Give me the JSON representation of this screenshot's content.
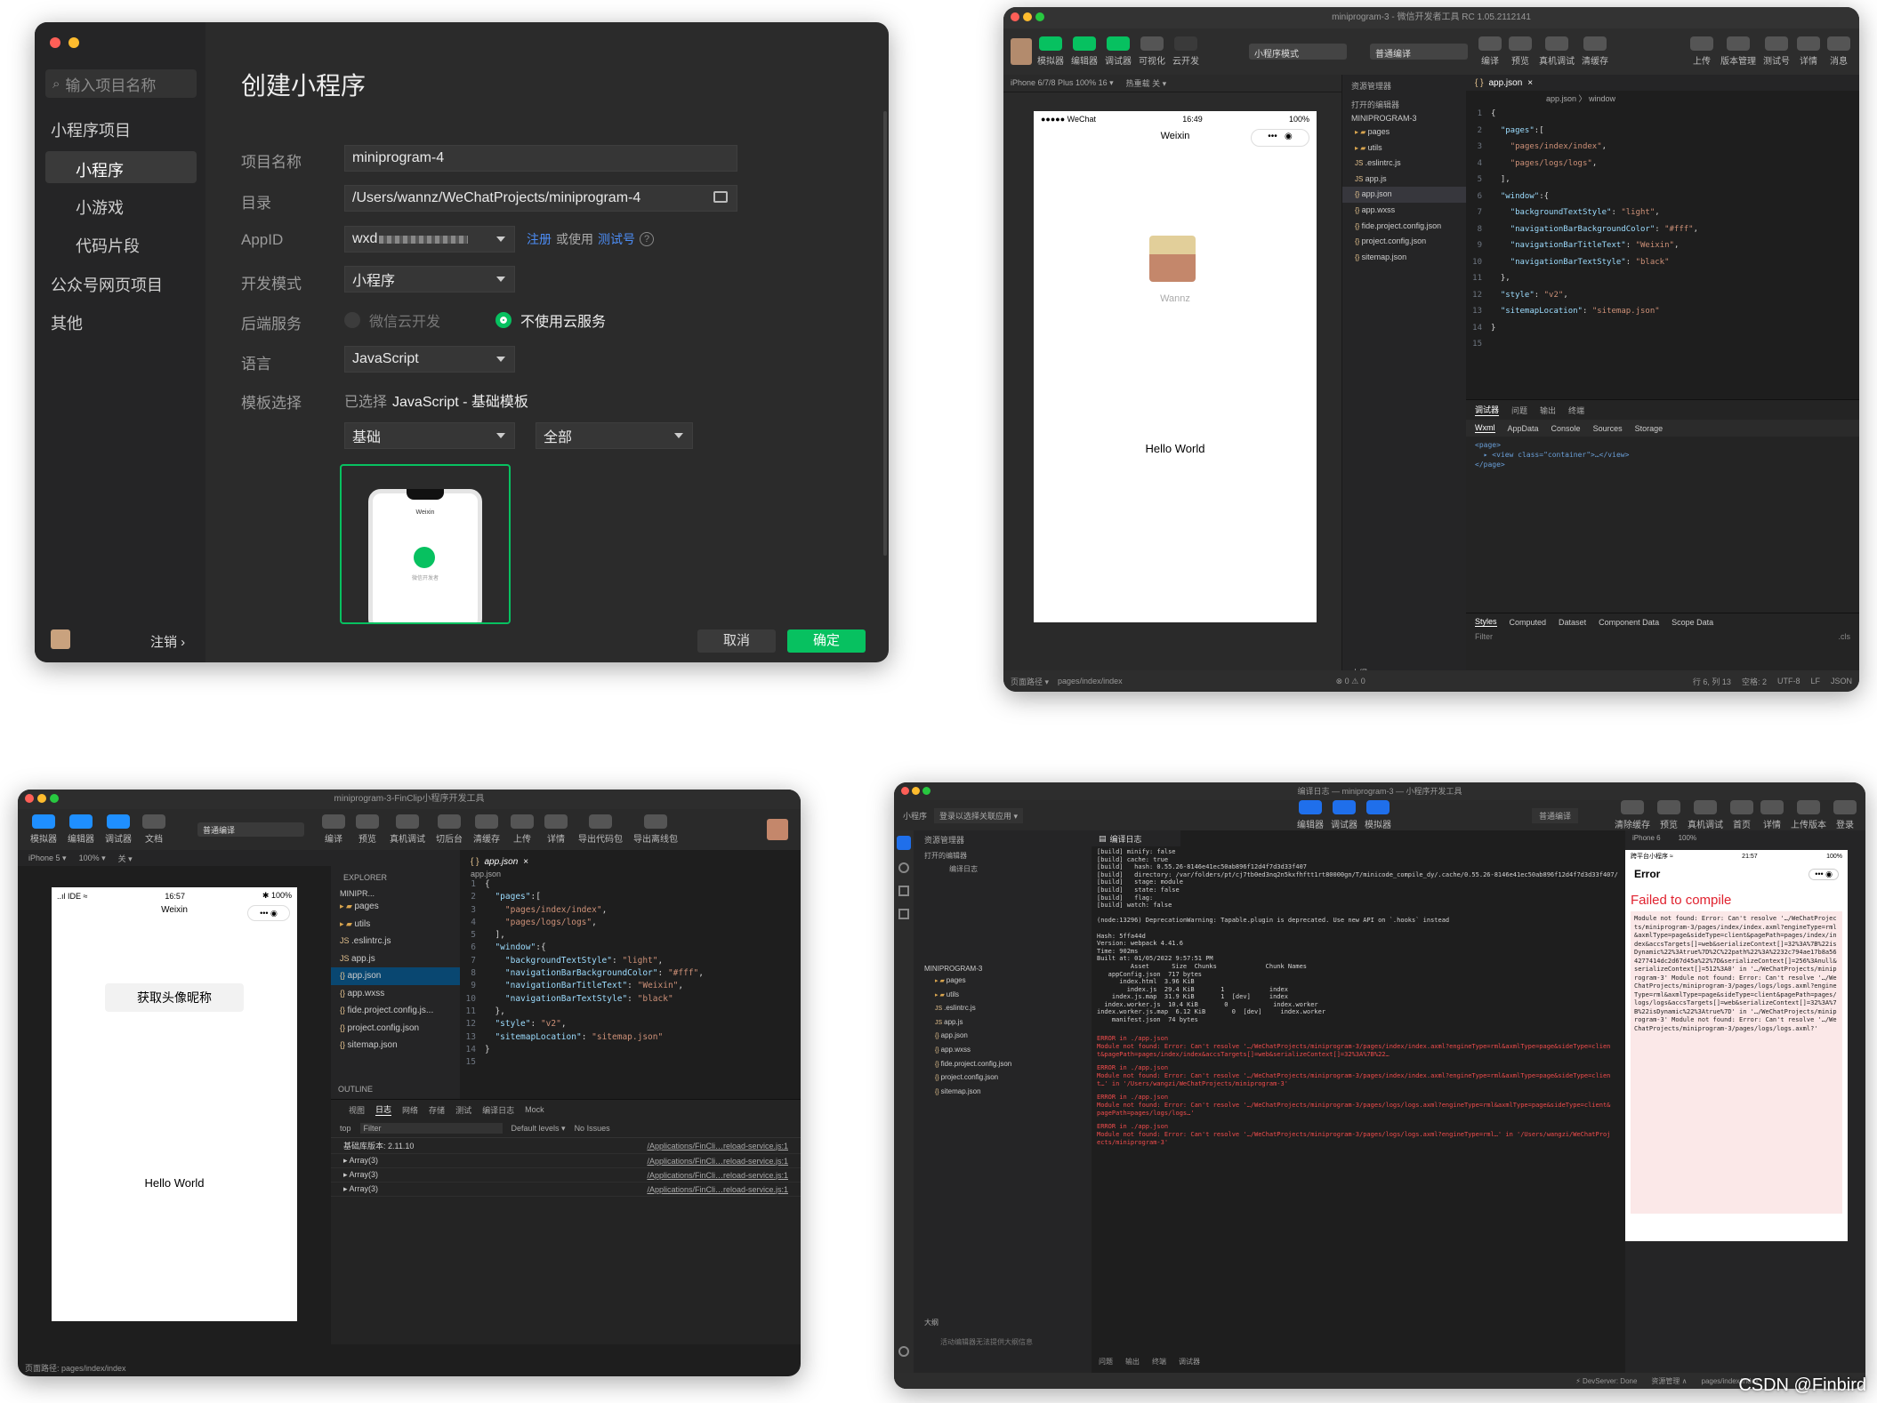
{
  "w1": {
    "search_placeholder": "输入项目名称",
    "nav": {
      "section1": "小程序项目",
      "mini": "小程序",
      "game": "小游戏",
      "snippet": "代码片段",
      "section2": "公众号网页项目",
      "other": "其他"
    },
    "logout": "注销 ›",
    "title": "创建小程序",
    "labels": {
      "name": "项目名称",
      "dir": "目录",
      "appid": "AppID",
      "mode": "开发模式",
      "backend": "后端服务",
      "lang": "语言",
      "template": "模板选择"
    },
    "values": {
      "name": "miniprogram-4",
      "dir": "/Users/wannz/WeChatProjects/miniprogram-4",
      "appid": "wxd",
      "mode": "小程序",
      "lang": "JavaScript",
      "cat1": "基础",
      "cat2": "全部"
    },
    "appid_links": {
      "register": "注册",
      "or_use": "或使用",
      "test": "测试号"
    },
    "backend": {
      "cloud": "微信云开发",
      "nocloud": "不使用云服务"
    },
    "template_selected": {
      "prefix": "已选择",
      "value": "JavaScript - 基础模板"
    },
    "preview": {
      "title": "Weixin",
      "caption": "微信开发者"
    },
    "buttons": {
      "cancel": "取消",
      "ok": "确定"
    }
  },
  "w2": {
    "title": "miniprogram-3 - 微信开发者工具 RC 1.05.2112141",
    "tools": [
      "模拟器",
      "编辑器",
      "调试器",
      "可视化",
      "云开发"
    ],
    "mode_select": "小程序模式",
    "compile_select": "普通编译",
    "right_tools": [
      "编译",
      "预览",
      "真机调试",
      "清缓存"
    ],
    "far_tools": [
      "上传",
      "版本管理",
      "测试号",
      "详情",
      "消息"
    ],
    "device": "iPhone 6/7/8 Plus 100% 16 ▾",
    "hot": "热重载 关 ▾",
    "phone": {
      "carrier": "●●●●● WeChat",
      "time": "16:49",
      "battery": "100%",
      "title": "Weixin",
      "nick": "Wannz",
      "hello": "Hello World"
    },
    "explorer": {
      "title": "资源管理器",
      "open": "打开的编辑器",
      "project": "MINIPROGRAM-3",
      "items": [
        "pages",
        "utils",
        ".eslintrc.js",
        "app.js",
        "app.json",
        "app.wxss",
        "fide.project.config.json",
        "project.config.json",
        "sitemap.json"
      ],
      "outline": "大纲"
    },
    "tab": "app.json",
    "breadcrumb": "app.json 〉 window",
    "code": [
      "{",
      "  \"pages\":[",
      "    \"pages/index/index\",",
      "    \"pages/logs/logs\"",
      "  ],",
      "  \"window\":{",
      "    \"backgroundTextStyle\":\"light\",",
      "    \"navigationBarBackgroundColor\": \"#fff\",",
      "    \"navigationBarTitleText\": \"Weixin\",",
      "    \"navigationBarTextStyle\":\"black\"",
      "  },",
      "  \"style\": \"v2\",",
      "  \"sitemapLocation\": \"sitemap.json\"",
      "}",
      ""
    ],
    "debug_tabs": [
      "调试器",
      "问题",
      "输出",
      "终端"
    ],
    "dev_tabs": [
      "Wxml",
      "AppData",
      "Console",
      "Sources",
      "Storage"
    ],
    "wxml": [
      "<page>",
      "  ▸ <view class=\"container\">…</view>",
      "</page>"
    ],
    "style_tabs": [
      "Styles",
      "Computed",
      "Dataset",
      "Component Data",
      "Scope Data"
    ],
    "filter": "Filter",
    "cls": ".cls",
    "status_left": "页面路径 ▾",
    "status_path": "pages/index/index",
    "status_errors": "⊗ 0 ⚠ 0",
    "status_right": [
      "行 6, 列 13",
      "空格: 2",
      "UTF-8",
      "LF",
      "JSON"
    ]
  },
  "w3": {
    "title": "miniprogram-3-FinClip小程序开发工具",
    "tools": [
      "模拟器",
      "编辑器",
      "调试器",
      "文档"
    ],
    "compile": "普通编译",
    "right_tools": [
      "编译",
      "预览",
      "真机调试",
      "切后台",
      "清缓存",
      "上传",
      "详情",
      "导出代码包",
      "导出离线包"
    ],
    "device": "iPhone 5 ▾",
    "zoom": "100% ▾",
    "hot": "关 ▾",
    "phone": {
      "carrier": "..ıl IDE ≈",
      "time": "16:57",
      "battery": "✱ 100%",
      "title": "Weixin",
      "button": "获取头像昵称",
      "hello": "Hello World"
    },
    "explorer": {
      "title": "EXPLORER",
      "project": "MINIPR...",
      "items": [
        "pages",
        "utils",
        ".eslintrc.js",
        "app.js",
        "app.json",
        "app.wxss",
        "fide.project.config.js...",
        "project.config.json",
        "sitemap.json"
      ],
      "outline": "OUTLINE"
    },
    "tab": "app.json",
    "breadcrumb": "app.json",
    "code": [
      "{",
      "  \"pages\":[",
      "    \"pages/index/index\",",
      "    \"pages/logs/logs\"",
      "  ],",
      "  \"window\":{",
      "    \"backgroundTextStyle\":\"light\",",
      "    \"navigationBarBackgroundColor\": \"#fff\",",
      "    \"navigationBarTitleText\": \"Weixin\",",
      "    \"navigationBarTextStyle\":\"black\"",
      "  },",
      "  \"style\": \"v2\",",
      "  \"sitemapLocation\": \"sitemap.json\"",
      "}",
      ""
    ],
    "debug_tabs": [
      "视图",
      "日志",
      "网络",
      "存储",
      "测试",
      "编译日志",
      "Mock"
    ],
    "console_top": "top",
    "filter": "Filter",
    "levels": "Default levels ▾",
    "issues": "No Issues",
    "console": [
      {
        "text": "基础库版本: 2.11.10",
        "src": "/Applications/FinCli…reload-service.js:1"
      },
      {
        "text": "▸ Array(3)",
        "src": "/Applications/FinCli…reload-service.js:1"
      },
      {
        "text": "▸ Array(3)",
        "src": "/Applications/FinCli…reload-service.js:1"
      },
      {
        "text": "▸ Array(3)",
        "src": "/Applications/FinCli…reload-service.js:1"
      }
    ],
    "status": "页面路径: pages/index/index"
  },
  "w4": {
    "title": "编译日志 — miniprogram-3 — 小程序开发工具",
    "app": "小程序",
    "login": "登录以选择关联应用 ▾",
    "center_tools": [
      "编辑器",
      "调试器",
      "模拟器"
    ],
    "compile": "普通编译",
    "right_tools": [
      "清除缓存",
      "预览",
      "真机调试",
      "首页",
      "详情",
      "上传版本",
      "登录"
    ],
    "explorer": {
      "title": "资源管理器",
      "open": "打开的编辑器",
      "log": "编译日志",
      "project": "MINIPROGRAM-3",
      "items": [
        "pages",
        "utils",
        ".eslintrc.js",
        "app.js",
        "app.json",
        "app.wxss",
        "fide.project.config.json",
        "project.config.json",
        "sitemap.json"
      ],
      "outline": "大纲",
      "outline_note": "活动编辑器无法提供大纲信息"
    },
    "tab": "编译日志",
    "log_white": [
      "[build] minify: false",
      "[build] cache: true",
      "[build]   hash: 0.55.26-8146e41ec50ab896f12d4f7d3d33f407",
      "[build]   directory: /var/folders/pt/cj7tb0ed3nq2n5kxfhftt1rt80000gn/T/minicode_compile_dy/.cache/0.55.26-8146e41ec50ab896f12d4f7d3d33f407/",
      "[build]   stage: module",
      "[build]   state: false",
      "[build]   flag:",
      "[build] watch: false",
      "",
      "(node:13296) DeprecationWarning: Tapable.plugin is deprecated. Use new API on `.hooks` instead",
      "",
      "Hash: 5ffa44d",
      "Version: webpack 4.41.6",
      "Time: 902ms",
      "Built at: 01/05/2022 9:57:51 PM",
      "         Asset      Size  Chunks             Chunk Names",
      "   appConfig.json  717 bytes",
      "      index.html  3.96 KiB",
      "        index.js  29.4 KiB       1            index",
      "    index.js.map  31.9 KiB       1  [dev]     index",
      "  index.worker.js  10.4 KiB       0            index.worker",
      "index.worker.js.map  6.12 KiB       0  [dev]     index.worker",
      "    manifest.json  74 bytes"
    ],
    "log_errors": [
      "ERROR in ./app.json",
      "Module not found: Error: Can't resolve '…/WeChatProjects/miniprogram-3/pages/index/index.axml?engineType=rml&axmlType=page&sideType=client&pagePath=pages/index/index&accsTargets[]=web&serializeContext[]=32%3A%7B%22…",
      "ERROR in ./app.json",
      "Module not found: Error: Can't resolve '…/WeChatProjects/miniprogram-3/pages/index/index.axml?engineType=rml&axmlType=page&sideType=client…' in '/Users/wangzi/WeChatProjects/miniprogram-3'",
      "ERROR in ./app.json",
      "Module not found: Error: Can't resolve '…/WeChatProjects/miniprogram-3/pages/logs/logs.axml?engineType=rml&axmlType=page&sideType=client&pagePath=pages/logs/logs…'",
      "ERROR in ./app.json",
      "Module not found: Error: Can't resolve '…/WeChatProjects/miniprogram-3/pages/logs/logs.axml?engineType=rml…' in '/Users/wangzi/WeChatProjects/miniprogram-3'"
    ],
    "bottom_tabs": [
      "问题",
      "输出",
      "终端",
      "调试器"
    ],
    "device": "iPhone 6",
    "zoom": "100%",
    "phone": {
      "carrier": "跨平台小程序 ≈",
      "time": "21:57",
      "battery": "100%",
      "title": "Error",
      "failed": "Failed to compile",
      "body": "Module not found: Error: Can't resolve '…/WeChatProjects/miniprogram-3/pages/index/index.axml?engineType=rml&axmlType=page&sideType=client&pagePath=pages/index/index&accsTargets[]=web&serializeContext[]=32%3A%7B%22isDynamic%22%3Atrue%7D%2C%22path%22%3A%2232c794ae17b8a564277414dc2d67d45a%22%7D&serializeContext[]=256%3Anull&serializeContext[]=512%3A0' in '…/WeChatProjects/miniprogram-3' Module not found: Error: Can't resolve '…/WeChatProjects/miniprogram-3/pages/logs/logs.axml?engineType=rml&axmlType=page&sideType=client&pagePath=pages/logs/logs&accsTargets[]=web&serializeContext[]=32%3A%7B%22isDynamic%22%3Atrue%7D' in '…/WeChatProjects/miniprogram-3' Module not found: Error: Can't resolve '…/WeChatProjects/miniprogram-3/pages/logs/logs.axml?'"
    },
    "status_right": [
      "⚡ DevServer: Done",
      "资源管理 ∧",
      "pages/index/index"
    ]
  },
  "watermark": "CSDN @Finbird"
}
